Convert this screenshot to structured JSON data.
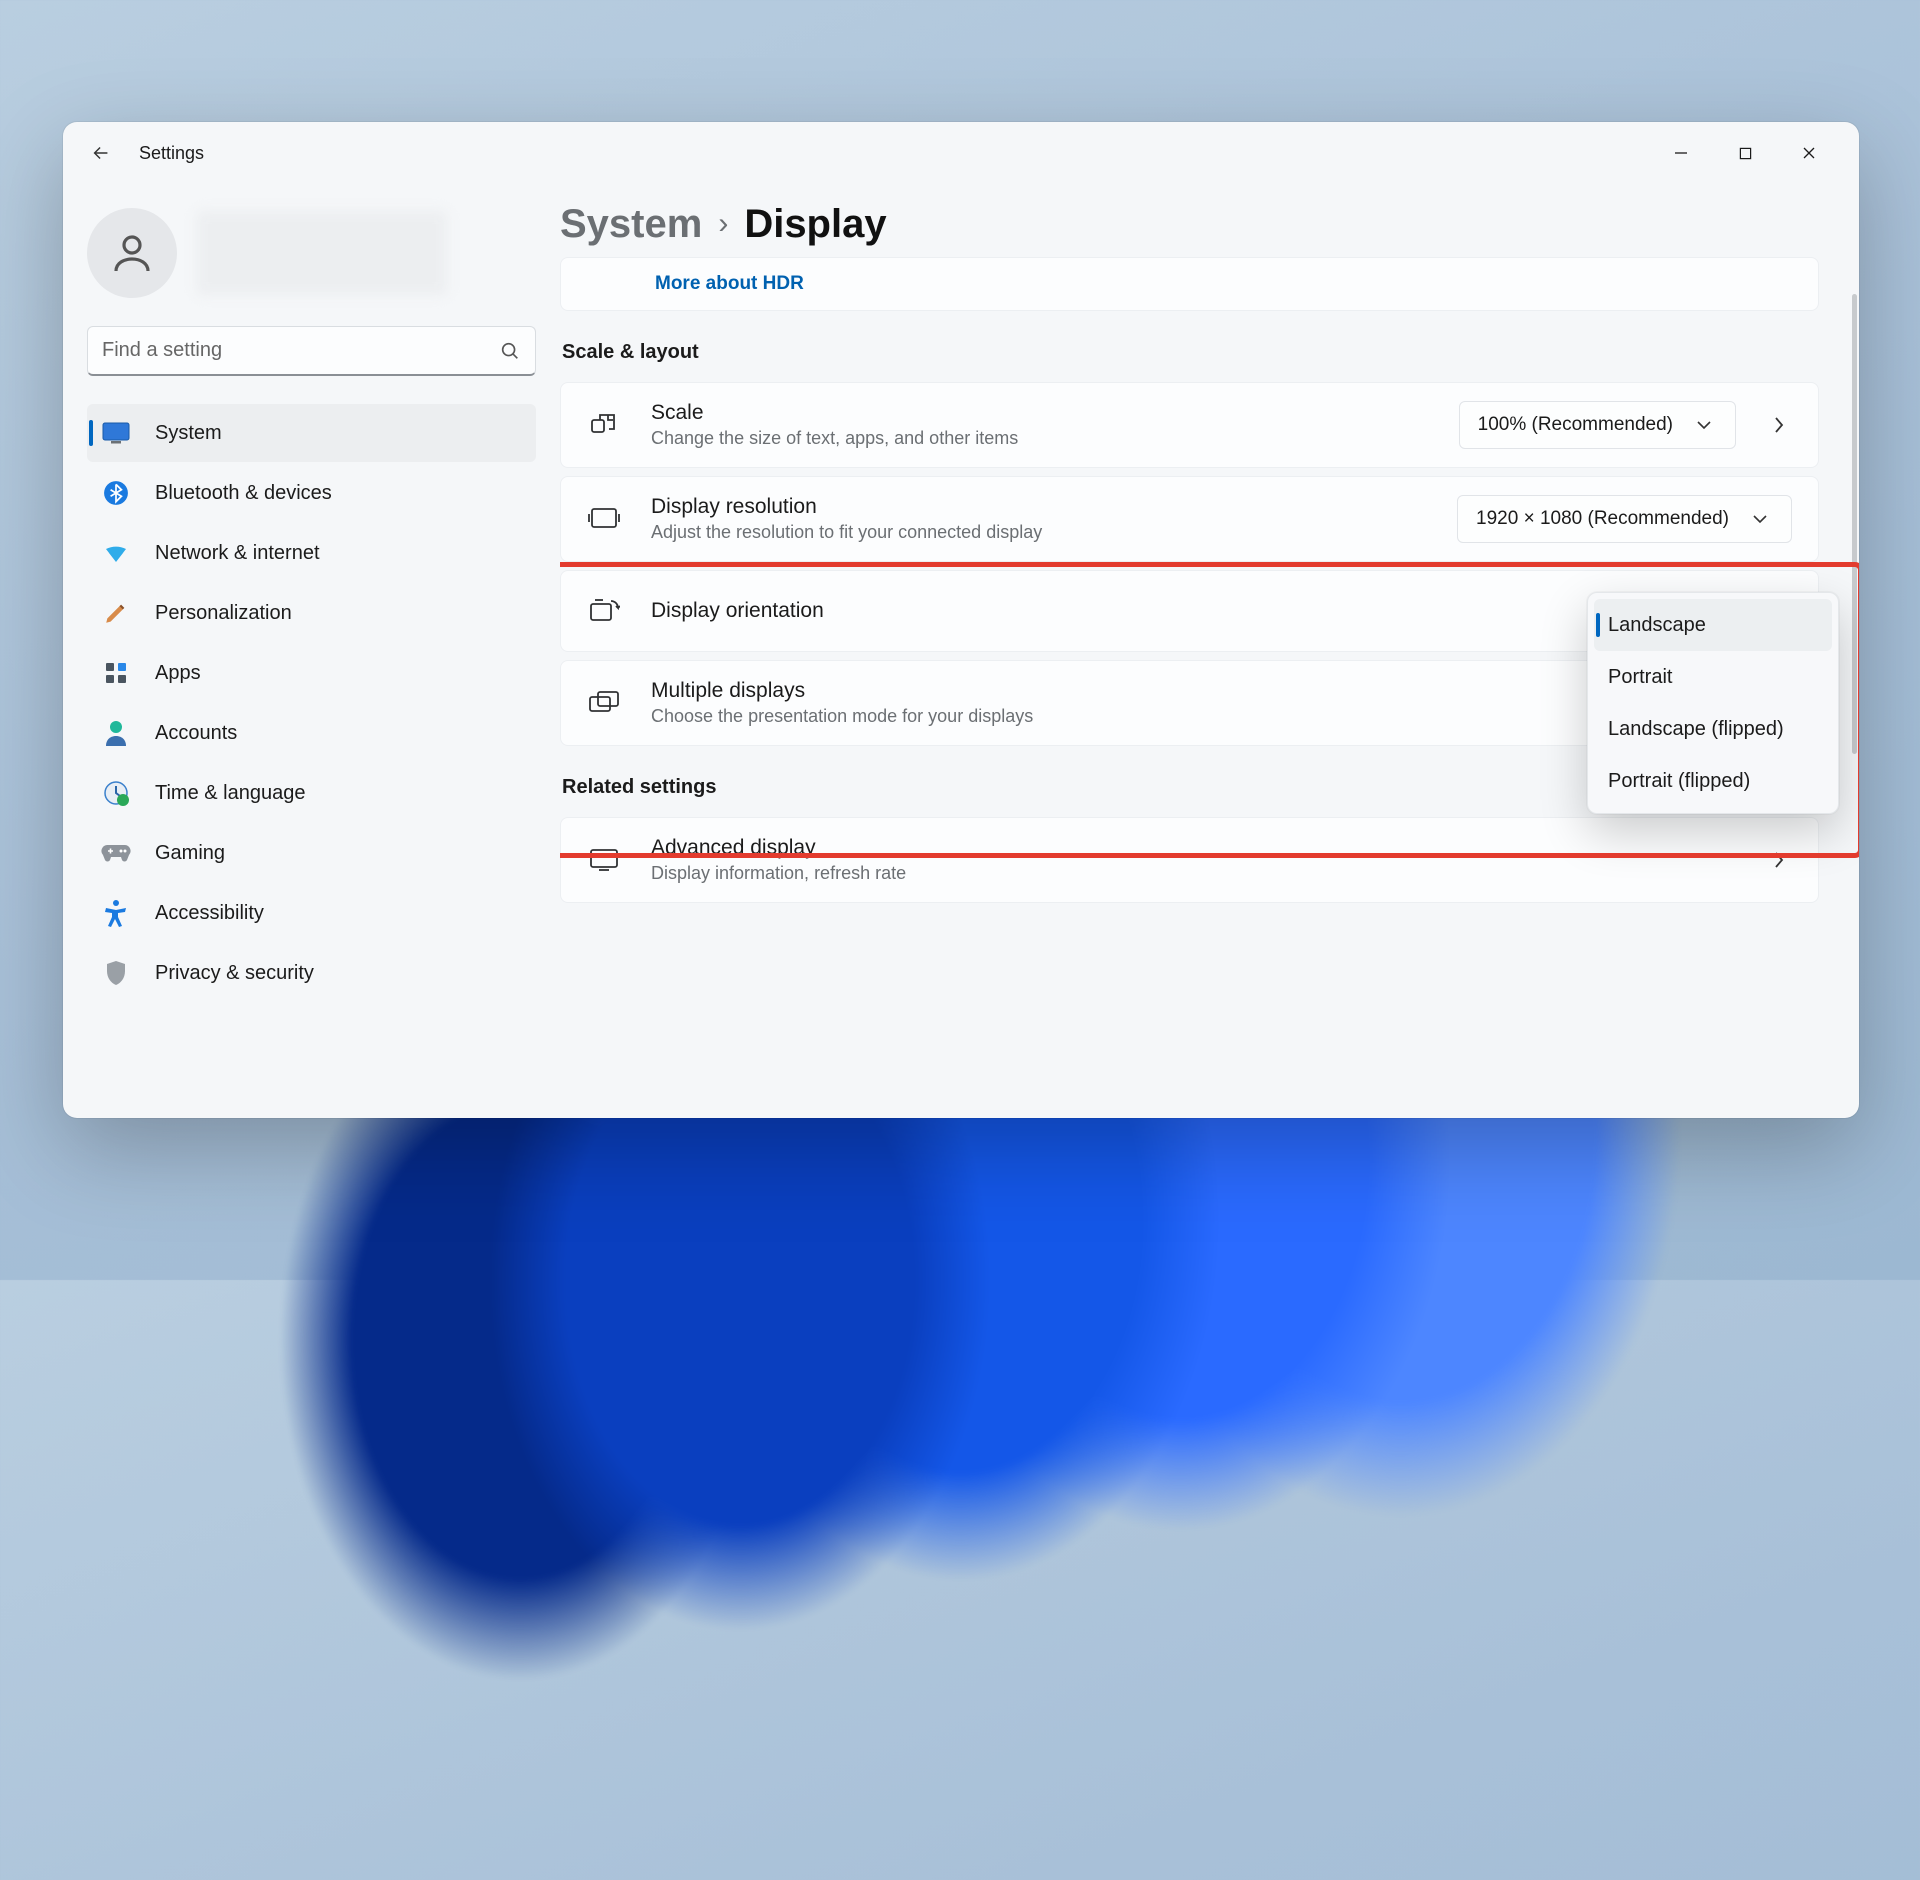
{
  "window": {
    "title": "Settings"
  },
  "search": {
    "placeholder": "Find a setting"
  },
  "nav": {
    "system": "System",
    "bluetooth": "Bluetooth & devices",
    "network": "Network & internet",
    "personalization": "Personalization",
    "apps": "Apps",
    "accounts": "Accounts",
    "time": "Time & language",
    "gaming": "Gaming",
    "accessibility": "Accessibility",
    "privacy": "Privacy & security"
  },
  "breadcrumb": {
    "parent": "System",
    "current": "Display"
  },
  "hdr_link": "More about HDR",
  "sections": {
    "scale_layout": "Scale & layout",
    "related": "Related settings"
  },
  "cards": {
    "scale": {
      "title": "Scale",
      "desc": "Change the size of text, apps, and other items",
      "value": "100% (Recommended)"
    },
    "resolution": {
      "title": "Display resolution",
      "desc": "Adjust the resolution to fit your connected display",
      "value": "1920 × 1080 (Recommended)"
    },
    "orientation": {
      "title": "Display orientation"
    },
    "multiple": {
      "title": "Multiple displays",
      "desc": "Choose the presentation mode for your displays"
    },
    "advanced": {
      "title": "Advanced display",
      "desc": "Display information, refresh rate"
    }
  },
  "orientation_options": {
    "landscape": "Landscape",
    "portrait": "Portrait",
    "landscape_flipped": "Landscape (flipped)",
    "portrait_flipped": "Portrait (flipped)"
  }
}
